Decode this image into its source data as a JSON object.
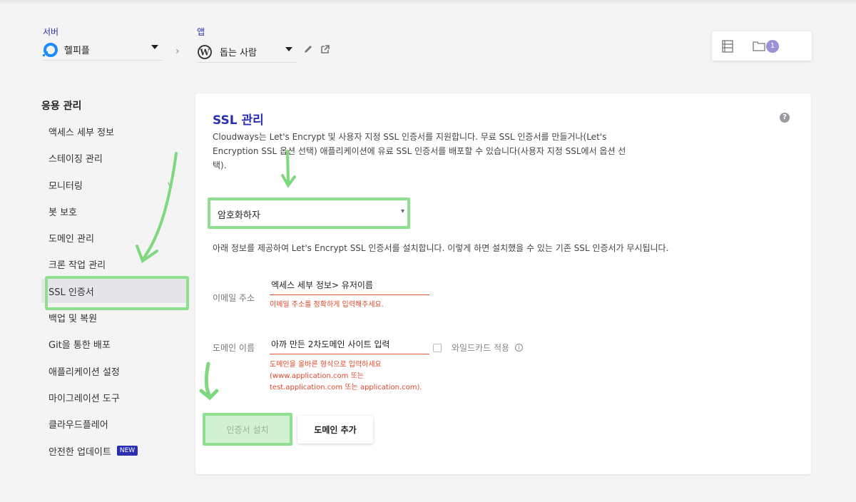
{
  "header": {
    "server_label": "서버",
    "server_name": "헬피플",
    "app_label": "앱",
    "app_name": "돕는 사람",
    "notification_count": "1"
  },
  "sidebar": {
    "title": "응용 관리",
    "items": [
      {
        "label": "액세스 세부 정보"
      },
      {
        "label": "스테이징 관리"
      },
      {
        "label": "모니터링"
      },
      {
        "label": "봇 보호"
      },
      {
        "label": "도메인 관리"
      },
      {
        "label": "크론 작업 관리"
      },
      {
        "label": "SSL 인증서"
      },
      {
        "label": "백업 및 복원"
      },
      {
        "label": "Git을 통한 배포"
      },
      {
        "label": "애플리케이션 설정"
      },
      {
        "label": "마이그레이션 도구"
      },
      {
        "label": "클라우드플레어"
      },
      {
        "label": "안전한 업데이트"
      }
    ],
    "new_badge": "NEW",
    "active_item": "SSL 인증서"
  },
  "main": {
    "title": "SSL 관리",
    "description": "Cloudways는 Let's Encrypt 및 사용자 지정 SSL 인증서를 지원합니다. 무료 SSL 인증서를 만들거나(Let's Encryption SSL 옵션 선택) 애플리케이션에 유료 SSL 인증서를 배포할 수 있습니다(사용자 지정 SSL에서 옵션 선택).",
    "ssl_option_value": "암호화하자",
    "info_text": "아래 정보를 제공하여 Let's Encrypt SSL 인증서를 설치합니다. 이렇게 하면 설치했을 수 있는 기존 SSL 인증서가 무시됩니다.",
    "email_label": "이메일 주소",
    "email_value": "엑세스 세부 정보> 유저이름",
    "email_error": "이메일 주소를 정확하게 입력해주세요.",
    "domain_label": "도메인 이름",
    "domain_value": "아까 만든 2차도메인 사이트 입력",
    "domain_error_1": "도메인을 올바른 형식으로 입력하세요",
    "domain_error_2": "(www.application.com 또는",
    "domain_error_3": "test.application.com 또는 application.com).",
    "wildcard_label": "와일드카드 적용",
    "install_button": "인증서 설치",
    "add_domain_button": "도메인 추가"
  },
  "colors": {
    "accent": "#2a2fb0",
    "error": "#e0472a",
    "highlight": "#8ee08e"
  }
}
